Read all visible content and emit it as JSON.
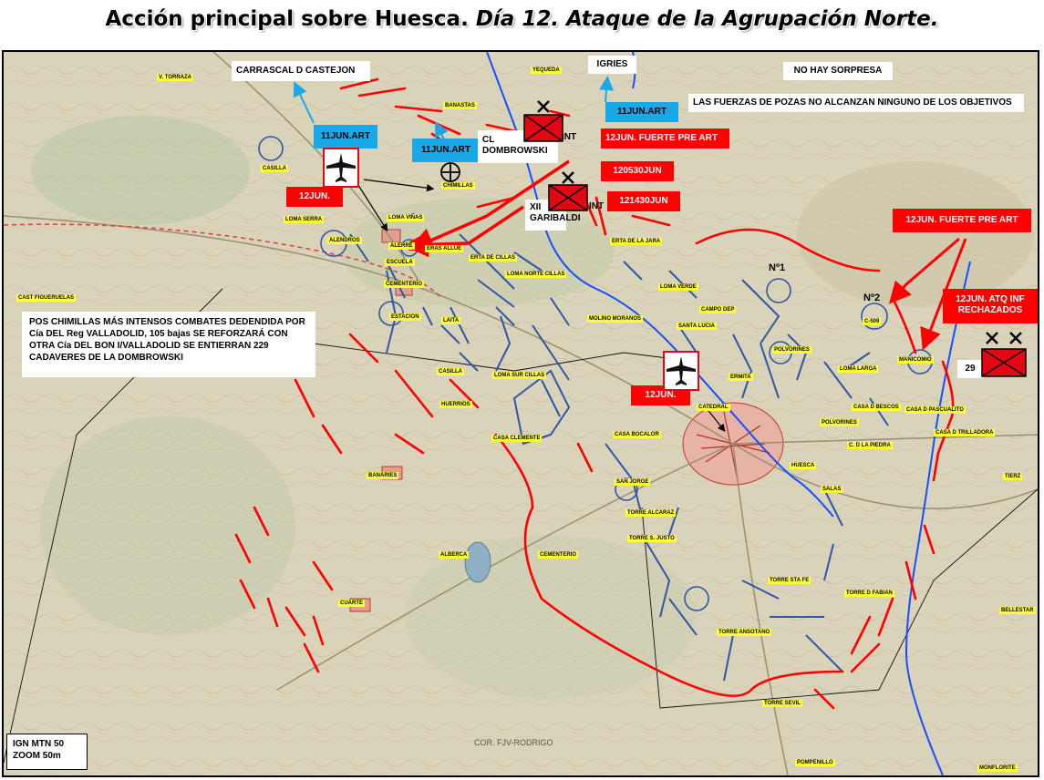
{
  "title": {
    "main": "Acción principal sobre Huesca. ",
    "italic": "Día 12. Ataque de la Agrupación Norte."
  },
  "labels": {
    "carrascal": "CARRASCAL D CASTEJON",
    "igries": "IGRIES",
    "no_sorpresa": "NO HAY SORPRESA",
    "pozas": "LAS FUERZAS DE POZAS NO ALCANZAN NINGUNO DE LOS OBJETIVOS",
    "art_11jun_a": "11JUN.ART",
    "art_11jun_b": "11JUN.ART",
    "art_11jun_c": "11JUN.ART",
    "cl_dombrowski": "CL\nDOMBROWSKI",
    "int_a": "INT",
    "int_b": "INT",
    "xii_garibaldi": "XII\nGARIBALDI",
    "fuerte_pre_art_12a": "12JUN. FUERTE PRE ART",
    "fuerte_pre_art_12b": "12JUN. FUERTE PRE ART",
    "h120530": "120530JUN",
    "h121430": "121430JUN",
    "jun12_a": "12JUN.",
    "jun12_b": "12JUN.",
    "atq_inf": "12JUN. ATQ INF\nRECHAZADOS",
    "n1": "Nº1",
    "n2": "Nº2",
    "unit29": "29"
  },
  "note": "POS CHIMILLAS MÁS INTENSOS COMBATES DEDENDIDA POR Cía DEL Reg VALLADOLID, 105 bajas SE REFORZARÁ CON OTRA Cía DEL BON I/VALLADOLID SE ENTIERRAN 229 CADAVERES DE LA DOMBROWSKI",
  "footer": {
    "line1": "IGN MTN 50",
    "line2": "ZOOM 50m"
  },
  "credit": "COR. FJV-RODRIGO",
  "places": [
    "V. TORRAZA",
    "CASILLA",
    "BANASTAS",
    "YEQUEDA",
    "CHIMILLAS",
    "LOMA SERRA",
    "LOMA VIÑAS",
    "ALENDROS",
    "ALERRE",
    "ESCUELA",
    "ERAS ALLUE",
    "ERTA DE CILLAS",
    "LOMA NORTE CILLAS",
    "ERTA DE LA JARA",
    "CAST FIGUERUELAS",
    "CEMENTERIO",
    "ESTACION",
    "LAITA",
    "MOLINO MORANOS",
    "LOMA VERDE",
    "CAMPO DEP",
    "SANTA LUCIA",
    "POLVORINES",
    "ERMITA",
    "LOMA LARGA",
    "MANICOMIO",
    "C-509",
    "CASILLA",
    "LOMA SUR CILLAS",
    "HUERRIOS",
    "CASA CLEMENTE",
    "CASA BOCALOR",
    "CATEDRAL",
    "HUESCA",
    "CASA D BESCOS",
    "CASA D PASCUALITO",
    "POLVORINES",
    "C. D LA PIEDRA",
    "CASA D TRILLADORA",
    "BANARIES",
    "SAN JORGE",
    "TORRE ALCARAZ",
    "TORRE S. JUSTO",
    "ALBERCA",
    "CEMENTERIO",
    "SALAS",
    "TORRE STA FE",
    "TORRE D FABIAN",
    "CUARTE",
    "TORRE ANSOTANO",
    "TORRE SEVIL",
    "POMPENILLO",
    "MONFLORITE",
    "BELLESTAR",
    "TIERZ"
  ],
  "colors": {
    "front_red": "#ff0000",
    "positions_blue": "#2f57a6",
    "river_blue": "#1450ff",
    "art_blue": "#1aa9e6",
    "unit_red": "#e30613"
  }
}
